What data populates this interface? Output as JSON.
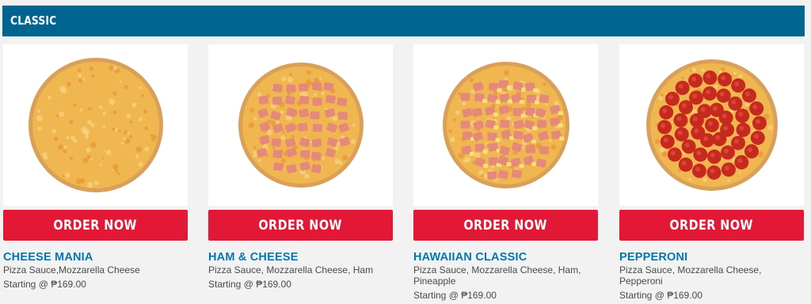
{
  "section": {
    "title": "CLASSIC"
  },
  "products": [
    {
      "name": "CHEESE MANIA",
      "description": "Pizza Sauce,Mozzarella Cheese",
      "price": "Starting @ ₱169.00",
      "button": "ORDER NOW",
      "topping": "cheese"
    },
    {
      "name": "HAM & CHEESE",
      "description": "Pizza Sauce, Mozzarella Cheese, Ham",
      "price": "Starting @ ₱169.00",
      "button": "ORDER NOW",
      "topping": "ham"
    },
    {
      "name": "HAWAIIAN CLASSIC",
      "description": "Pizza Sauce, Mozzarella Cheese, Ham, Pineapple",
      "price": "Starting @ ₱169.00",
      "button": "ORDER NOW",
      "topping": "hawaiian"
    },
    {
      "name": "PEPPERONI",
      "description": "Pizza Sauce, Mozzarella Cheese, Pepperoni",
      "price": "Starting @ ₱169.00",
      "button": "ORDER NOW",
      "topping": "pepperoni"
    }
  ],
  "colors": {
    "header_bg": "#006491",
    "button_bg": "#e31837",
    "name_text": "#0078ae"
  }
}
